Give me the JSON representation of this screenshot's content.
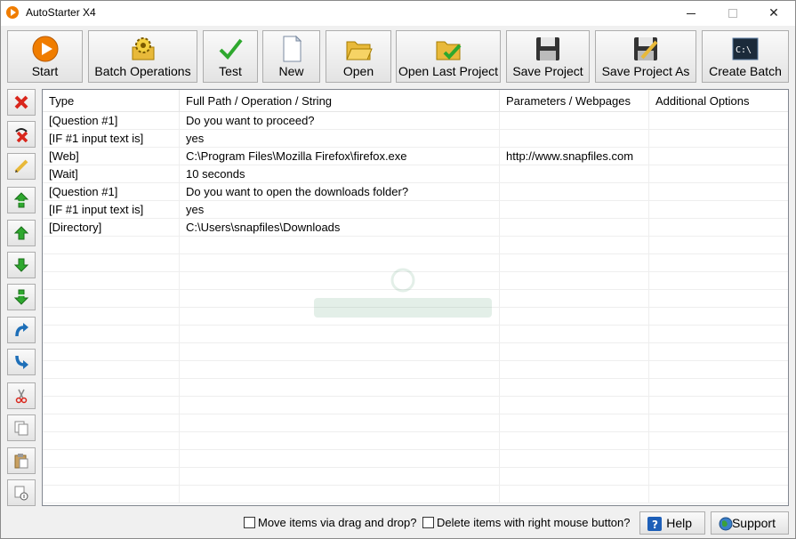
{
  "window": {
    "title": "AutoStarter X4"
  },
  "toolbar": {
    "buttons": [
      {
        "label": "Start",
        "icon": "play-circle-icon"
      },
      {
        "label": "Batch Operations",
        "icon": "gear-folder-icon"
      },
      {
        "label": "Test",
        "icon": "checkmark-icon"
      },
      {
        "label": "New",
        "icon": "new-document-icon"
      },
      {
        "label": "Open",
        "icon": "folder-open-icon"
      },
      {
        "label": "Open Last Project",
        "icon": "folder-check-icon"
      },
      {
        "label": "Save Project",
        "icon": "floppy-disk-icon"
      },
      {
        "label": "Save Project As",
        "icon": "floppy-pencil-icon"
      },
      {
        "label": "Create Batch",
        "icon": "command-prompt-icon"
      }
    ]
  },
  "sidebar": {
    "buttons": [
      {
        "name": "delete-item-button",
        "icon": "red-x-icon"
      },
      {
        "name": "delete-all-button",
        "icon": "undo-x-icon"
      },
      {
        "name": "edit-item-button",
        "icon": "pencil-icon"
      },
      {
        "name": "move-top-button",
        "icon": "double-up-arrow-icon"
      },
      {
        "name": "move-up-button",
        "icon": "up-arrow-icon"
      },
      {
        "name": "move-down-button",
        "icon": "down-arrow-icon"
      },
      {
        "name": "move-bottom-button",
        "icon": "double-down-arrow-icon"
      },
      {
        "name": "rotate-up-button",
        "icon": "curved-up-arrow-icon"
      },
      {
        "name": "rotate-down-button",
        "icon": "curved-down-arrow-icon"
      },
      {
        "name": "cut-button",
        "icon": "scissors-icon"
      },
      {
        "name": "copy-button",
        "icon": "copy-icon"
      },
      {
        "name": "paste-button",
        "icon": "clipboard-icon"
      },
      {
        "name": "duplicate-button",
        "icon": "duplicate-icon"
      }
    ]
  },
  "grid": {
    "columns": [
      "Type",
      "Full Path / Operation / String",
      "Parameters / Webpages",
      "Additional Options"
    ],
    "rows": [
      [
        "[Question #1]",
        "Do you want to proceed?",
        "",
        ""
      ],
      [
        "[IF #1 input text is]",
        "yes",
        "",
        ""
      ],
      [
        "[Web]",
        "C:\\Program Files\\Mozilla Firefox\\firefox.exe",
        "http://www.snapfiles.com",
        ""
      ],
      [
        "[Wait]",
        "10 seconds",
        "",
        ""
      ],
      [
        "[Question #1]",
        "Do you want to open the downloads folder?",
        "",
        ""
      ],
      [
        "[IF #1 input text is]",
        "yes",
        "",
        ""
      ],
      [
        "[Directory]",
        "C:\\Users\\snapfiles\\Downloads",
        "",
        ""
      ]
    ],
    "empty_rows": 15
  },
  "footer": {
    "drag_drop_label": "Move items via drag and drop?",
    "right_click_delete_label": "Delete items with right mouse button?",
    "help_label": "Help",
    "support_label": "Support"
  },
  "colors": {
    "accent_orange": "#f07d00",
    "arrow_green": "#2ea82e",
    "delete_red": "#d9261c"
  }
}
